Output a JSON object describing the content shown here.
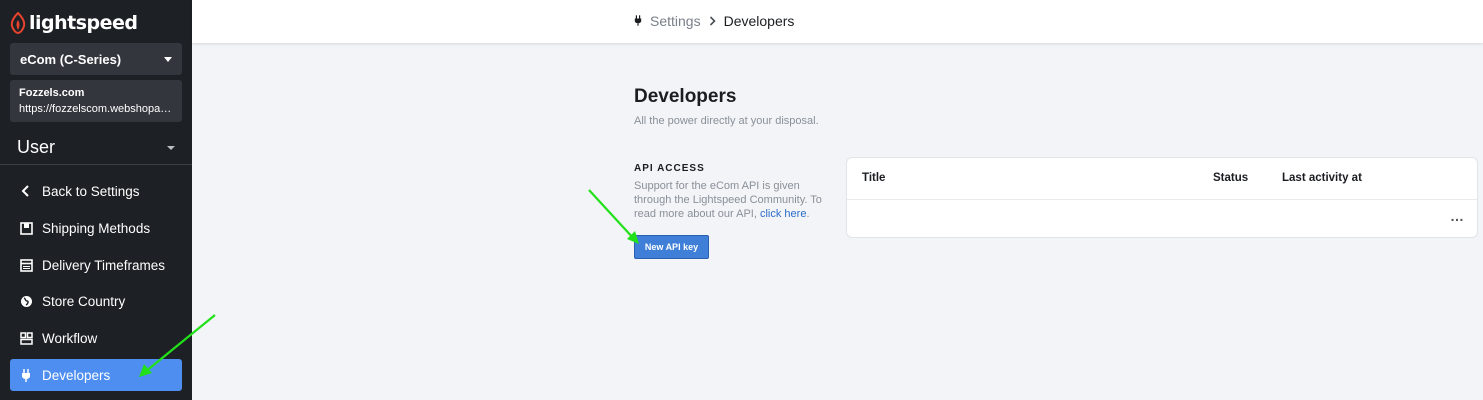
{
  "app": {
    "logo_text": "lightspeed"
  },
  "sidebar": {
    "store_selector": "eCom (C-Series)",
    "shop": {
      "name": "Fozzels.com",
      "url": "https://fozzelscom.webshopapp.com"
    },
    "user_label": "User",
    "items": [
      {
        "label": "Back to Settings",
        "icon": "chevron-left-icon"
      },
      {
        "label": "Shipping Methods",
        "icon": "box-icon"
      },
      {
        "label": "Delivery Timeframes",
        "icon": "calendar-icon"
      },
      {
        "label": "Store Country",
        "icon": "globe-icon"
      },
      {
        "label": "Workflow",
        "icon": "workflow-icon"
      },
      {
        "label": "Developers",
        "icon": "plug-icon",
        "active": true
      }
    ]
  },
  "breadcrumb": {
    "parent": "Settings",
    "current": "Developers"
  },
  "page": {
    "title": "Developers",
    "subtitle": "All the power directly at your disposal.",
    "section_title": "API ACCESS",
    "section_desc": "Support for the eCom API is given through the Lightspeed Community. To read more about our API,",
    "section_link": "click here",
    "new_key_button": "New API key"
  },
  "table": {
    "columns": [
      "Title",
      "Status",
      "Last activity at"
    ],
    "row_menu": "…"
  },
  "colors": {
    "accent": "#4d8ef0",
    "sidebar_bg": "#1d2024",
    "annotation_arrow": "#22e01a"
  }
}
